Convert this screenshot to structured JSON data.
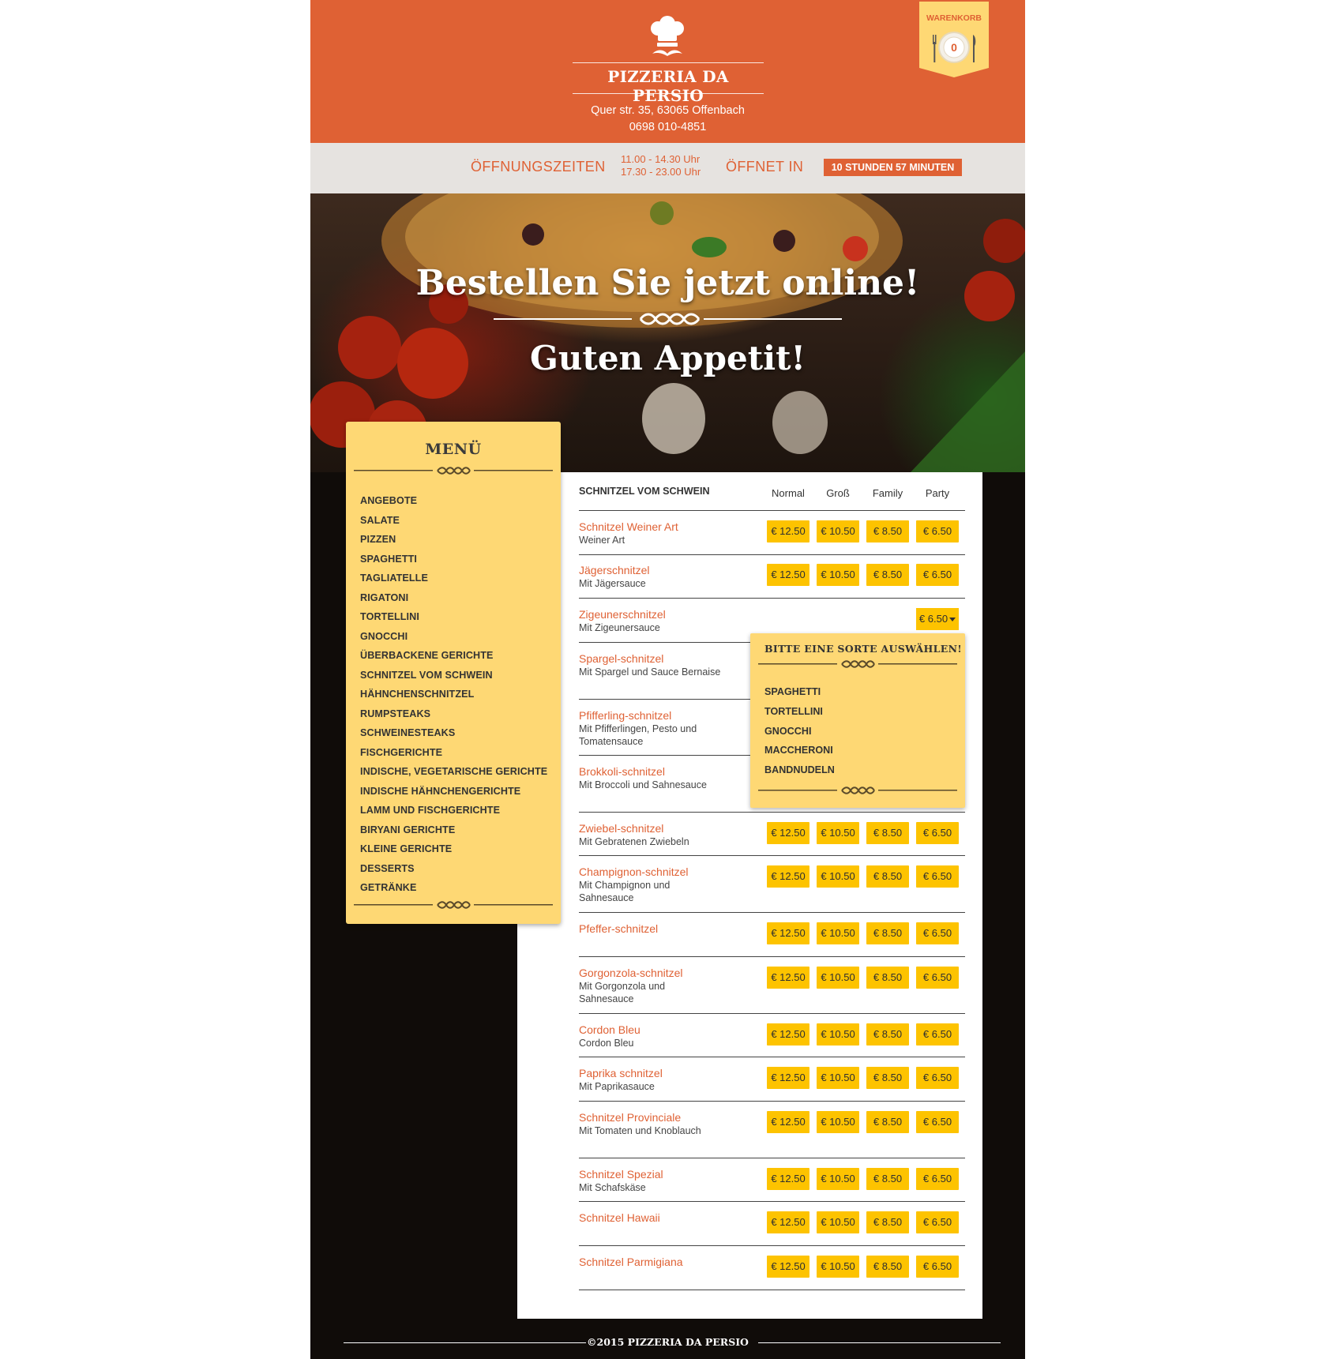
{
  "header": {
    "site_title": "PIZZERIA DA PERSIO",
    "address_line": "Quer str. 35, 63065 Offenbach",
    "phone": "0698 010-4851",
    "cart_label": "WARENKORB",
    "cart_count": "0"
  },
  "hours": {
    "label": "ÖFFNUNGSZEITEN",
    "time_1": "11.00 - 14.30 Uhr",
    "time_2": "17.30 - 23.00 Uhr",
    "opens_label": "ÖFFNET IN",
    "countdown": "10 STUNDEN 57 MINUTEN"
  },
  "hero": {
    "title": "Bestellen Sie jetzt online!",
    "subtitle": "Guten Appetit!"
  },
  "menu": {
    "title": "MENÜ",
    "items": [
      "ANGEBOTE",
      "SALATE",
      "PIZZEN",
      "SPAGHETTI",
      "TAGLIATELLE",
      "RIGATONI",
      "TORTELLINI",
      "GNOCCHI",
      "ÜBERBACKENE GERICHTE",
      "SCHNITZEL VOM SCHWEIN",
      "HÄHNCHENSCHNITZEL",
      "RUMPSTEAKS",
      "SCHWEINESTEAKS",
      "FISCHGERICHTE",
      "INDISCHE, VEGETARISCHE GERICHTE",
      "INDISCHE HÄHNCHENGERICHTE",
      "LAMM UND FISCHGERICHTE",
      "BIRYANI GERICHTE",
      "KLEINE GERICHTE",
      "DESSERTS",
      "GETRÄNKE"
    ]
  },
  "section": {
    "title": "SCHNITZEL VOM SCHWEIN",
    "columns": [
      "Normal",
      "Groß",
      "Family",
      "Party"
    ]
  },
  "products": [
    {
      "name": "Schnitzel Weiner Art",
      "desc": "Weiner Art",
      "prices": [
        "€ 12.50",
        "€ 10.50",
        "€ 8.50",
        "€ 6.50"
      ]
    },
    {
      "name": "Jägerschnitzel",
      "desc": "Mit Jägersauce",
      "prices": [
        "€ 12.50",
        "€ 10.50",
        "€ 8.50",
        "€ 6.50"
      ]
    },
    {
      "name": "Zigeunerschnitzel",
      "desc": "Mit Zigeunersauce",
      "dropdown_price": "€ 6.50"
    },
    {
      "name": "Spargel-schnitzel",
      "desc": "Mit Spargel und Sauce Bernaise"
    },
    {
      "name": "Pfifferling-schnitzel",
      "desc": "Mit Pfifferlingen, Pesto und Tomatensauce"
    },
    {
      "name": "Brokkoli-schnitzel",
      "desc": "Mit Broccoli und Sahnesauce"
    },
    {
      "name": "Zwiebel-schnitzel",
      "desc": "Mit Gebratenen Zwiebeln",
      "prices": [
        "€ 12.50",
        "€ 10.50",
        "€ 8.50",
        "€ 6.50"
      ]
    },
    {
      "name": "Champignon-schnitzel",
      "desc": "Mit Champignon und Sahnesauce",
      "prices": [
        "€ 12.50",
        "€ 10.50",
        "€ 8.50",
        "€ 6.50"
      ]
    },
    {
      "name": "Pfeffer-schnitzel",
      "desc": "",
      "prices": [
        "€ 12.50",
        "€ 10.50",
        "€ 8.50",
        "€ 6.50"
      ]
    },
    {
      "name": "Gorgonzola-schnitzel",
      "desc": "Mit Gorgonzola und Sahnesauce",
      "prices": [
        "€ 12.50",
        "€ 10.50",
        "€ 8.50",
        "€ 6.50"
      ]
    },
    {
      "name": "Cordon Bleu",
      "desc": "Cordon Bleu",
      "prices": [
        "€ 12.50",
        "€ 10.50",
        "€ 8.50",
        "€ 6.50"
      ]
    },
    {
      "name": "Paprika schnitzel",
      "desc": "Mit Paprikasauce",
      "prices": [
        "€ 12.50",
        "€ 10.50",
        "€ 8.50",
        "€ 6.50"
      ]
    },
    {
      "name": "Schnitzel Provinciale",
      "desc": "Mit Tomaten und Knoblauch",
      "prices": [
        "€ 12.50",
        "€ 10.50",
        "€ 8.50",
        "€ 6.50"
      ]
    },
    {
      "name": "Schnitzel Spezial",
      "desc": "Mit Schafskäse",
      "prices": [
        "€ 12.50",
        "€ 10.50",
        "€ 8.50",
        "€ 6.50"
      ]
    },
    {
      "name": "Schnitzel Hawaii",
      "desc": "",
      "prices": [
        "€ 12.50",
        "€ 10.50",
        "€ 8.50",
        "€ 6.50"
      ]
    },
    {
      "name": "Schnitzel Parmigiana",
      "desc": "",
      "prices": [
        "€ 12.50",
        "€ 10.50",
        "€ 8.50",
        "€ 6.50"
      ]
    }
  ],
  "dropdown": {
    "title": "BITTE EINE SORTE AUSWÄHLEN!",
    "options": [
      "SPAGHETTI",
      "TORTELLINI",
      "GNOCCHI",
      "MACCHERONI",
      "BANDNUDELN"
    ]
  },
  "footer": {
    "copyright": "©2015 PIZZERIA DA PERSIO"
  },
  "colors": {
    "brand_orange": "#df6134",
    "menu_yellow": "#fed874",
    "price_yellow": "#fdc300",
    "dark_background": "#100c09"
  },
  "icons": [
    "chef-hat-icon",
    "mustache-icon",
    "plate-icon",
    "fork-icon",
    "knife-icon",
    "flourish-icon",
    "chevron-down-icon"
  ]
}
